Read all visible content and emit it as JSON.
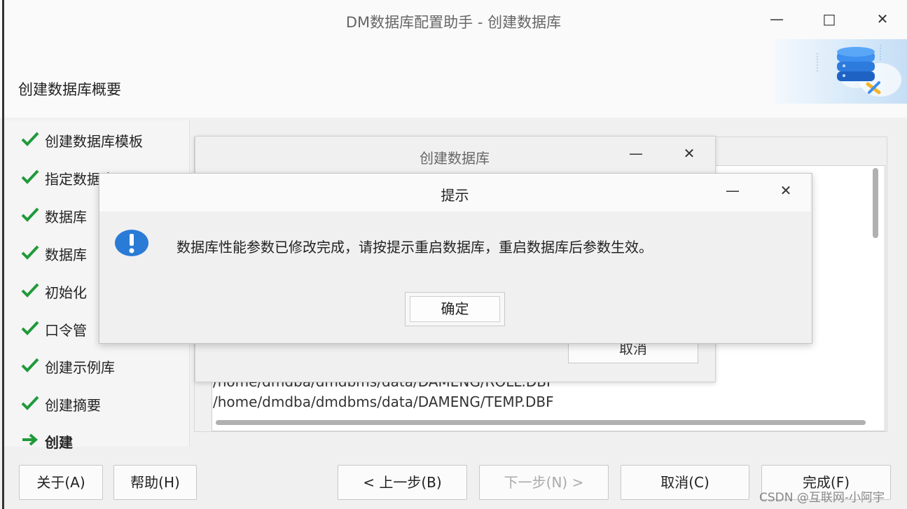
{
  "window": {
    "title": "DM数据库配置助手 - 创建数据库",
    "heading": "创建数据库概要"
  },
  "steps": [
    {
      "label": "创建数据库模板",
      "status": "done"
    },
    {
      "label": "指定数据库",
      "status": "done"
    },
    {
      "label": "数据库",
      "status": "done"
    },
    {
      "label": "数据库",
      "status": "done"
    },
    {
      "label": "初始化",
      "status": "done"
    },
    {
      "label": "口令管",
      "status": "done"
    },
    {
      "label": "创建示例库",
      "status": "done"
    },
    {
      "label": "创建摘要",
      "status": "done"
    },
    {
      "label": "创建",
      "status": "current"
    }
  ],
  "log_lines": [
    "/home/dmdba/dmdbms/data/DAMENG/ROLL.DBF",
    "/home/dmdba/dmdbms/data/DAMENG/TEMP.DBF"
  ],
  "progress_dialog": {
    "title": "创建数据库",
    "cancel_label": "取消"
  },
  "alert_dialog": {
    "title": "提示",
    "message": "数据库性能参数已修改完成，请按提示重启数据库，重启数据库后参数生效。",
    "ok_label": "确定",
    "icon": "info-icon"
  },
  "buttons": {
    "about": "关于(A)",
    "help": "帮助(H)",
    "prev": "< 上一步(B)",
    "next": "下一步(N) >",
    "cancel": "取消(C)",
    "finish": "完成(F)"
  },
  "watermark": "CSDN @互联网-小阿宇",
  "colors": {
    "accent": "#2a7bd6",
    "check": "#1f9a3a"
  }
}
